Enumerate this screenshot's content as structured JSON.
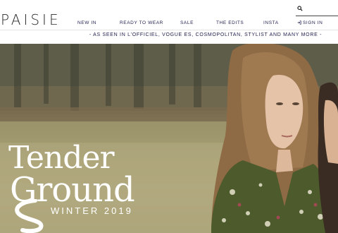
{
  "brand": {
    "logo": "PAISIE"
  },
  "nav": {
    "items": [
      "NEW IN",
      "READY TO WEAR",
      "SALE",
      "THE EDITS",
      "INSTA"
    ],
    "signin": "SIGN IN"
  },
  "search": {
    "icon": "search-icon",
    "placeholder": ""
  },
  "press": "- AS SEEN IN L'OFFICIEL, VOGUE ES, COSMOPOLITAN, STYLIST AND MANY MORE -",
  "hero": {
    "title_line1": "Tender",
    "title_line2": "Ground",
    "subtitle": "WINTER 2019"
  },
  "colors": {
    "nav_text": "#1d1d4f",
    "hero_text": "#ffffff"
  }
}
